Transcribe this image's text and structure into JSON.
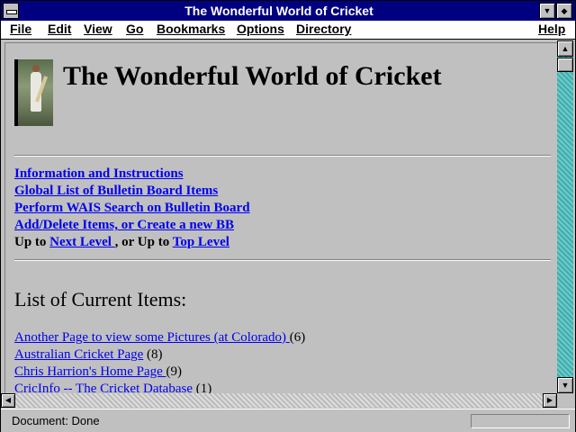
{
  "window": {
    "title": "The Wonderful World of Cricket"
  },
  "menu": [
    "File",
    "Edit",
    "View",
    "Go",
    "Bookmarks",
    "Options",
    "Directory",
    "Help"
  ],
  "page": {
    "heading": "The Wonderful World of Cricket",
    "nav_links": [
      "Information and Instructions",
      "Global List of Bulletin Board Items",
      "Perform WAIS Search on Bulletin Board",
      "Add/Delete Items, or Create a new BB"
    ],
    "upto": {
      "prefix": "Up to ",
      "next_level": "Next Level ",
      "middle": ", or Up to ",
      "top_level": "Top Level "
    },
    "list_heading": "List of Current Items:",
    "items": [
      {
        "label": "Another Page to view some Pictures (at Colorado) ",
        "count": "(6)"
      },
      {
        "label": "Australian Cricket Page",
        "count": " (8)"
      },
      {
        "label": "Chris Harrion's Home Page ",
        "count": "(9)"
      },
      {
        "label": "CricInfo -- The Cricket Database",
        "count": " (1)"
      }
    ]
  },
  "status": {
    "text": "Document: Done"
  },
  "icons": {
    "system_menu": "system-menu-icon",
    "minimize": "down-triangle",
    "maximize": "up-down-triangle",
    "scroll_up": "up-arrow",
    "scroll_down": "down-arrow",
    "scroll_left": "left-arrow",
    "scroll_right": "right-arrow"
  },
  "colors": {
    "titlebar": "#000080",
    "link": "#0000ee",
    "background": "#c0c0c0",
    "scroll_track": "#44aaaa"
  }
}
